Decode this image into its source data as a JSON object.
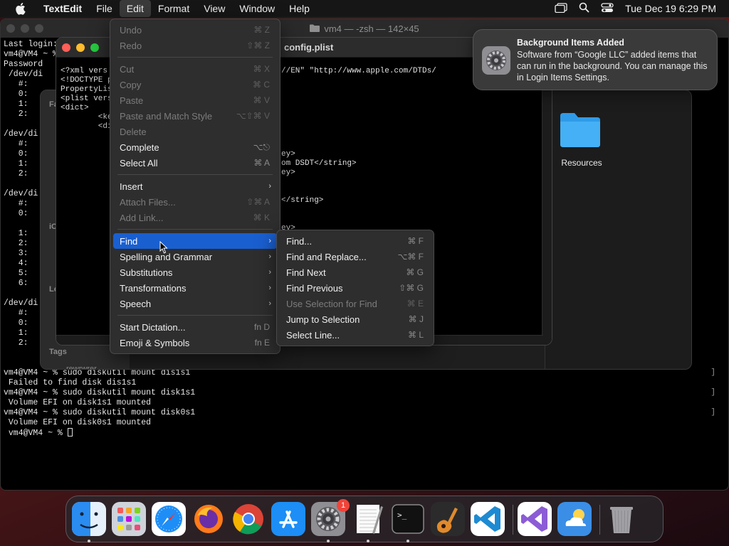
{
  "menubar": {
    "app_name": "TextEdit",
    "items": [
      "File",
      "Edit",
      "Format",
      "View",
      "Window",
      "Help"
    ],
    "clock": "Tue Dec 19  6:29 PM"
  },
  "terminal": {
    "title": "vm4 — -zsh — 142×45",
    "top_lines": [
      "Last login:",
      "vm4@VM4 ~ %",
      "Password",
      " /dev/di",
      "   #:",
      "   0:",
      "   1:",
      "   2:",
      "",
      "/dev/di",
      "   #:",
      "   0:",
      "   1:",
      "   2:",
      "",
      "/dev/di",
      "   #:",
      "   0:",
      "",
      "   1:",
      "   2:",
      "   3:",
      "   4:",
      "   5:",
      "   6:",
      "",
      "/dev/di",
      "   #:",
      "   0:",
      "   1:",
      "   2:"
    ],
    "bottom_lines": [
      "vm4@VM4 ~ % sudo diskutil mount dis1s1",
      " Failed to find disk dis1s1",
      "vm4@VM4 ~ % sudo diskutil mount disk1s1",
      " Volume EFI on disk1s1 mounted",
      "vm4@VM4 ~ % sudo diskutil mount disk0s1",
      " Volume EFI on disk0s1 mounted",
      " vm4@VM4 ~ % "
    ]
  },
  "finder": {
    "sidebar_labels": [
      "Fa",
      "iC",
      "Lo",
      "Tags"
    ],
    "folder_name": "Resources",
    "partial_text": "rewrwrer"
  },
  "textedit": {
    "title": "config.plist",
    "left_lines": [
      "<?xml vers",
      "<!DOCTYPE p",
      "PropertyLis",
      "<plist vers",
      "<dict>",
      "        <ke",
      "        <di"
    ],
    "right_lines": [
      {
        "text": "//EN\" \"http://www.apple.com/DTDs/",
        "row": 0
      },
      {
        "text": "ey>",
        "row": 9
      },
      {
        "text": "om DSDT</string>",
        "row": 10
      },
      {
        "text": "ey>",
        "row": 11
      },
      {
        "text": "</string>",
        "row": 14
      },
      {
        "text": "ey>",
        "row": 17
      }
    ]
  },
  "edit_menu": {
    "groups": [
      [
        {
          "label": "Undo",
          "shortcut": "⌘ Z",
          "disabled": true
        },
        {
          "label": "Redo",
          "shortcut": "⇧⌘ Z",
          "disabled": true
        }
      ],
      [
        {
          "label": "Cut",
          "shortcut": "⌘ X",
          "disabled": true
        },
        {
          "label": "Copy",
          "shortcut": "⌘ C",
          "disabled": true
        },
        {
          "label": "Paste",
          "shortcut": "⌘ V",
          "disabled": true
        },
        {
          "label": "Paste and Match Style",
          "shortcut": "⌥⇧⌘ V",
          "disabled": true
        },
        {
          "label": "Delete",
          "shortcut": "",
          "disabled": true
        },
        {
          "label": "Complete",
          "shortcut": "⌥⎋",
          "disabled": false
        },
        {
          "label": "Select All",
          "shortcut": "⌘ A",
          "disabled": false
        }
      ],
      [
        {
          "label": "Insert",
          "submenu": true,
          "disabled": false
        },
        {
          "label": "Attach Files...",
          "shortcut": "⇧⌘ A",
          "disabled": true
        },
        {
          "label": "Add Link...",
          "shortcut": "⌘ K",
          "disabled": true
        }
      ],
      [
        {
          "label": "Find",
          "submenu": true,
          "highlight": true
        },
        {
          "label": "Spelling and Grammar",
          "submenu": true
        },
        {
          "label": "Substitutions",
          "submenu": true
        },
        {
          "label": "Transformations",
          "submenu": true
        },
        {
          "label": "Speech",
          "submenu": true
        }
      ],
      [
        {
          "label": "Start Dictation...",
          "shortcut": "fn D"
        },
        {
          "label": "Emoji & Symbols",
          "shortcut": "fn E"
        }
      ]
    ]
  },
  "find_submenu": [
    {
      "label": "Find...",
      "shortcut": "⌘ F",
      "disabled": false
    },
    {
      "label": "Find and Replace...",
      "shortcut": "⌥⌘ F",
      "disabled": false
    },
    {
      "label": "Find Next",
      "shortcut": "⌘ G",
      "disabled": false
    },
    {
      "label": "Find Previous",
      "shortcut": "⇧⌘ G",
      "disabled": false
    },
    {
      "label": "Use Selection for Find",
      "shortcut": "⌘ E",
      "disabled": true
    },
    {
      "label": "Jump to Selection",
      "shortcut": "⌘ J",
      "disabled": false
    },
    {
      "label": "Select Line...",
      "shortcut": "⌘ L",
      "disabled": false
    }
  ],
  "notification": {
    "title": "Background Items Added",
    "body": "Software from “Google LLC” added items that can run in the background. You can manage this in Login Items Settings."
  },
  "dock": {
    "items": [
      {
        "name": "finder",
        "running": true
      },
      {
        "name": "launchpad",
        "running": false
      },
      {
        "name": "safari",
        "running": false
      },
      {
        "name": "firefox",
        "running": false
      },
      {
        "name": "chrome",
        "running": false
      },
      {
        "name": "app-store",
        "running": false
      },
      {
        "name": "system-settings",
        "running": true,
        "badge": "1"
      },
      {
        "name": "textedit",
        "running": true
      },
      {
        "name": "terminal",
        "running": true
      },
      {
        "name": "garageband",
        "running": false
      },
      {
        "name": "vscode",
        "running": false
      },
      {
        "name": "visual-studio",
        "running": false
      },
      {
        "name": "weather",
        "running": false
      },
      {
        "name": "trash",
        "running": false
      }
    ]
  }
}
